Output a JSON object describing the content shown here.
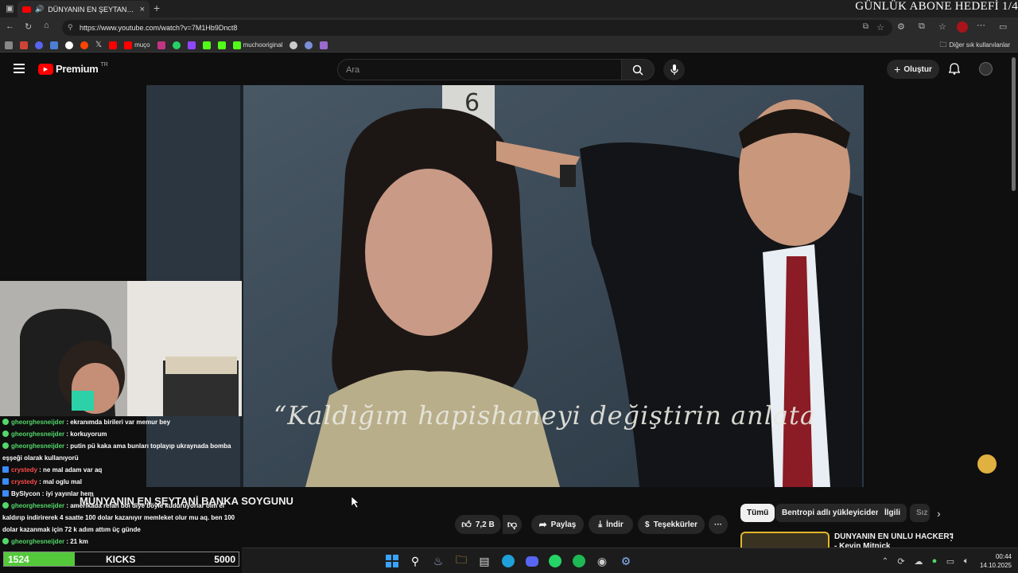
{
  "browser": {
    "tab_title": "DÜNYANIN EN ŞEYTANİ BANK",
    "url": "https://www.youtube.com/watch?v=7M1Hb9Dnct8",
    "bookmarks": [
      "muço",
      "muchooriginal"
    ],
    "other_bookmarks": "Diğer sık kullanılanlar",
    "new_tab": "+",
    "close_tab": "×"
  },
  "overlay": {
    "abone_hedefi": "GÜNLÜK ABONE HEDEFİ 1/4",
    "kicks_current": "1524",
    "kicks_label": "KICKS",
    "kicks_goal": "5000",
    "kicks_progress": 0.3
  },
  "youtube": {
    "logo_text": "Premium",
    "logo_suffix": "TR",
    "search_placeholder": "Ara",
    "create_label": "Oluştur",
    "video_subtitle": "“Kaldığım hapishaneyi değiştirin anlata",
    "video_title": "MÜNYANIN EN ŞEYTANİ BANKA SOYGUNU",
    "likes": "7,2 B",
    "share_label": "Paylaş",
    "download_label": "İndir",
    "thanks_label": "Teşekkürler",
    "chips": [
      "Tümü",
      "Bentropi adlı yükleyiciden",
      "İlgili",
      "Sız"
    ],
    "next_video_title": "DÜNYANIN EN ÜNLÜ HACKER'I - Kevin Mitnick"
  },
  "chat": [
    {
      "user": "gheorghesneijder",
      "msg": "ekranımda birileri var memur bey",
      "type": "green"
    },
    {
      "user": "gheorghesneijder",
      "msg": "korkuyorum",
      "type": "green"
    },
    {
      "user": "gheorghesneijder",
      "msg": "putin pü kaka ama bunları toplayıp ukraynada bomba eşşeği olarak kullanıyorü",
      "type": "green"
    },
    {
      "user": "crystedy",
      "msg": "ne mal adam var aq",
      "type": "red"
    },
    {
      "user": "crystedy",
      "msg": "mal oglu mal",
      "type": "red"
    },
    {
      "user": "BySlycon",
      "msg": "iyi yayınlar hem",
      "type": "white"
    },
    {
      "user": "gheorghesneijder",
      "msg": "amerikada refah boi diye böyle kuduruyorlar olm el kaldırıp indirirerek 4 saatte 100 dolar kazanıyır memleket olur mu aq. ben 100 dolar kazanmak için 72 k adım attım üç günde",
      "type": "green"
    },
    {
      "user": "gheorghesneijder",
      "msg": "21 km",
      "type": "green"
    }
  ],
  "clock": {
    "time": "00:44",
    "date": "14.10.2025"
  }
}
